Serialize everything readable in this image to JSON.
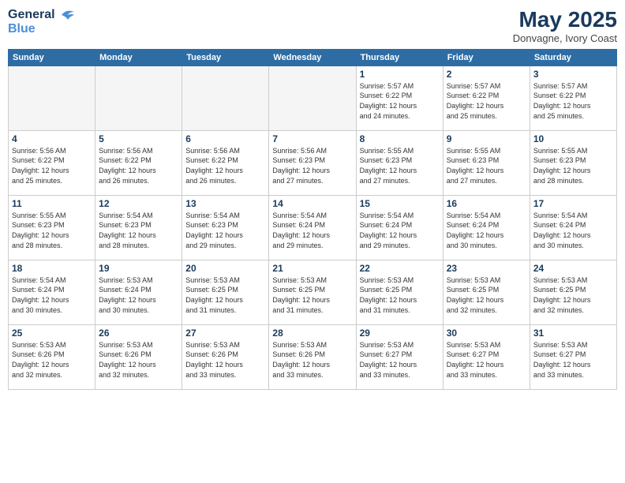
{
  "logo": {
    "line1": "General",
    "line2": "Blue"
  },
  "title": {
    "month_year": "May 2025",
    "location": "Donvagne, Ivory Coast"
  },
  "header_days": [
    "Sunday",
    "Monday",
    "Tuesday",
    "Wednesday",
    "Thursday",
    "Friday",
    "Saturday"
  ],
  "weeks": [
    [
      {
        "day": "",
        "info": ""
      },
      {
        "day": "",
        "info": ""
      },
      {
        "day": "",
        "info": ""
      },
      {
        "day": "",
        "info": ""
      },
      {
        "day": "1",
        "info": "Sunrise: 5:57 AM\nSunset: 6:22 PM\nDaylight: 12 hours\nand 24 minutes."
      },
      {
        "day": "2",
        "info": "Sunrise: 5:57 AM\nSunset: 6:22 PM\nDaylight: 12 hours\nand 25 minutes."
      },
      {
        "day": "3",
        "info": "Sunrise: 5:57 AM\nSunset: 6:22 PM\nDaylight: 12 hours\nand 25 minutes."
      }
    ],
    [
      {
        "day": "4",
        "info": "Sunrise: 5:56 AM\nSunset: 6:22 PM\nDaylight: 12 hours\nand 25 minutes."
      },
      {
        "day": "5",
        "info": "Sunrise: 5:56 AM\nSunset: 6:22 PM\nDaylight: 12 hours\nand 26 minutes."
      },
      {
        "day": "6",
        "info": "Sunrise: 5:56 AM\nSunset: 6:22 PM\nDaylight: 12 hours\nand 26 minutes."
      },
      {
        "day": "7",
        "info": "Sunrise: 5:56 AM\nSunset: 6:23 PM\nDaylight: 12 hours\nand 27 minutes."
      },
      {
        "day": "8",
        "info": "Sunrise: 5:55 AM\nSunset: 6:23 PM\nDaylight: 12 hours\nand 27 minutes."
      },
      {
        "day": "9",
        "info": "Sunrise: 5:55 AM\nSunset: 6:23 PM\nDaylight: 12 hours\nand 27 minutes."
      },
      {
        "day": "10",
        "info": "Sunrise: 5:55 AM\nSunset: 6:23 PM\nDaylight: 12 hours\nand 28 minutes."
      }
    ],
    [
      {
        "day": "11",
        "info": "Sunrise: 5:55 AM\nSunset: 6:23 PM\nDaylight: 12 hours\nand 28 minutes."
      },
      {
        "day": "12",
        "info": "Sunrise: 5:54 AM\nSunset: 6:23 PM\nDaylight: 12 hours\nand 28 minutes."
      },
      {
        "day": "13",
        "info": "Sunrise: 5:54 AM\nSunset: 6:23 PM\nDaylight: 12 hours\nand 29 minutes."
      },
      {
        "day": "14",
        "info": "Sunrise: 5:54 AM\nSunset: 6:24 PM\nDaylight: 12 hours\nand 29 minutes."
      },
      {
        "day": "15",
        "info": "Sunrise: 5:54 AM\nSunset: 6:24 PM\nDaylight: 12 hours\nand 29 minutes."
      },
      {
        "day": "16",
        "info": "Sunrise: 5:54 AM\nSunset: 6:24 PM\nDaylight: 12 hours\nand 30 minutes."
      },
      {
        "day": "17",
        "info": "Sunrise: 5:54 AM\nSunset: 6:24 PM\nDaylight: 12 hours\nand 30 minutes."
      }
    ],
    [
      {
        "day": "18",
        "info": "Sunrise: 5:54 AM\nSunset: 6:24 PM\nDaylight: 12 hours\nand 30 minutes."
      },
      {
        "day": "19",
        "info": "Sunrise: 5:53 AM\nSunset: 6:24 PM\nDaylight: 12 hours\nand 30 minutes."
      },
      {
        "day": "20",
        "info": "Sunrise: 5:53 AM\nSunset: 6:25 PM\nDaylight: 12 hours\nand 31 minutes."
      },
      {
        "day": "21",
        "info": "Sunrise: 5:53 AM\nSunset: 6:25 PM\nDaylight: 12 hours\nand 31 minutes."
      },
      {
        "day": "22",
        "info": "Sunrise: 5:53 AM\nSunset: 6:25 PM\nDaylight: 12 hours\nand 31 minutes."
      },
      {
        "day": "23",
        "info": "Sunrise: 5:53 AM\nSunset: 6:25 PM\nDaylight: 12 hours\nand 32 minutes."
      },
      {
        "day": "24",
        "info": "Sunrise: 5:53 AM\nSunset: 6:25 PM\nDaylight: 12 hours\nand 32 minutes."
      }
    ],
    [
      {
        "day": "25",
        "info": "Sunrise: 5:53 AM\nSunset: 6:26 PM\nDaylight: 12 hours\nand 32 minutes."
      },
      {
        "day": "26",
        "info": "Sunrise: 5:53 AM\nSunset: 6:26 PM\nDaylight: 12 hours\nand 32 minutes."
      },
      {
        "day": "27",
        "info": "Sunrise: 5:53 AM\nSunset: 6:26 PM\nDaylight: 12 hours\nand 33 minutes."
      },
      {
        "day": "28",
        "info": "Sunrise: 5:53 AM\nSunset: 6:26 PM\nDaylight: 12 hours\nand 33 minutes."
      },
      {
        "day": "29",
        "info": "Sunrise: 5:53 AM\nSunset: 6:27 PM\nDaylight: 12 hours\nand 33 minutes."
      },
      {
        "day": "30",
        "info": "Sunrise: 5:53 AM\nSunset: 6:27 PM\nDaylight: 12 hours\nand 33 minutes."
      },
      {
        "day": "31",
        "info": "Sunrise: 5:53 AM\nSunset: 6:27 PM\nDaylight: 12 hours\nand 33 minutes."
      }
    ]
  ]
}
